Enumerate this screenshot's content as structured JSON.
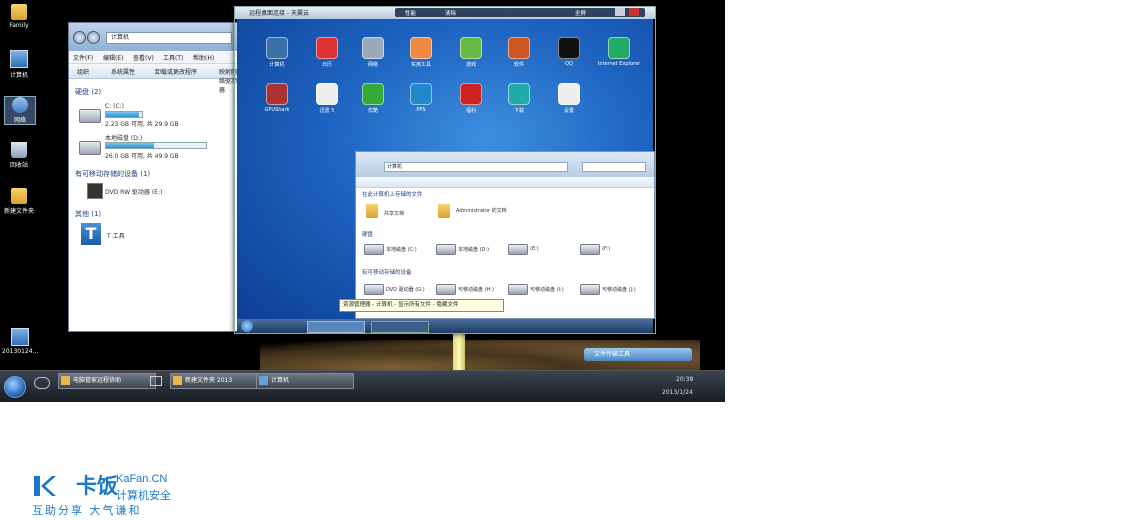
{
  "desktop": {
    "icons": [
      {
        "name": "folder-icon",
        "label": "Family"
      },
      {
        "name": "computer-icon",
        "label": "计算机"
      },
      {
        "name": "network-icon",
        "label": "网络"
      },
      {
        "name": "recycle-bin-icon",
        "label": "回收站"
      },
      {
        "name": "folder-icon",
        "label": "新建文件夹"
      },
      {
        "name": "screenshot-icon",
        "label": "20130124..."
      }
    ]
  },
  "explorer": {
    "address": "计算机",
    "menu": [
      "文件(F)",
      "编辑(E)",
      "查看(V)",
      "工具(T)",
      "帮助(H)"
    ],
    "toolbar": [
      "组织",
      "系统属性",
      "卸载或更改程序",
      "映射网络驱动器"
    ],
    "groups": {
      "hard_drives": "硬盘 (2)",
      "removable": "有可移动存储的设备 (1)",
      "other": "其他 (1)"
    },
    "drives": [
      {
        "label": "C: (C:)",
        "detail": "2.23 GB 可用, 共 29.9 GB",
        "fill": 0.93
      },
      {
        "label": "本地磁盘 (D:)",
        "detail": "26.0 GB 可用, 共 49.9 GB",
        "fill": 0.48
      }
    ],
    "dvd": "DVD RW 驱动器 (E:)",
    "other_item": "T 工具"
  },
  "remote": {
    "title": "远程桌面连接 - 天翼云",
    "toolbar": [
      "性能",
      "清除",
      "全屏"
    ],
    "icons_row1": [
      "计算机",
      "日历",
      "网络",
      "实用工具",
      "游戏",
      "软件",
      "QQ",
      "Internet Explorer"
    ],
    "icons_row2": [
      "GPUShark",
      "迅雷 5",
      "优酷",
      "PPS",
      "福利",
      "下载",
      "设置"
    ],
    "inner_explorer": {
      "address": "计算机",
      "group_top": "在此计算机上存储的文件",
      "folders": [
        "共享文档",
        "Administrator 的文档"
      ],
      "group_drives": "硬盘",
      "drives": [
        "本地磁盘 (C:)",
        "本地磁盘 (D:)",
        "(E:)",
        "(F:)"
      ],
      "group_removable": "有可移动存储的设备",
      "removable": [
        "DVD 驱动器 (G:)",
        "可移动磁盘 (H:)",
        "可移动磁盘 (I:)",
        "可移动磁盘 (J:)"
      ]
    },
    "tooltip": "资源管理器 - 计算机 - 显示所有文件 - 隐藏文件"
  },
  "float_bar": "文件传输工具",
  "taskbar": {
    "items": [
      "电脑管家远程协助",
      "新建文件夹 2013",
      "计算机"
    ],
    "time": "20:38",
    "date": "2013/1/24"
  },
  "logo": {
    "brand_cn": "卡饭",
    "brand_en": "KaFan.CN",
    "brand_sub": "计算机安全",
    "slogan": "互助分享  大气谦和",
    "color": "#1a78c8"
  }
}
